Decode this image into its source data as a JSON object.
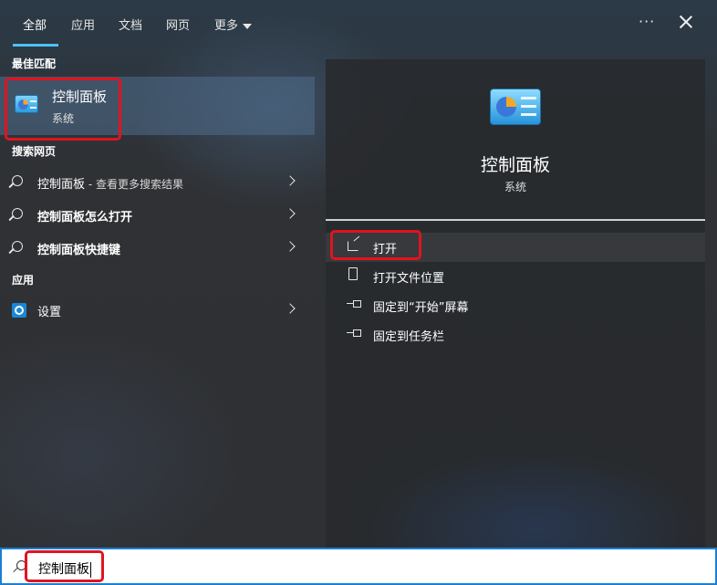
{
  "tabs": [
    {
      "label": "全部",
      "active": true
    },
    {
      "label": "应用"
    },
    {
      "label": "文档"
    },
    {
      "label": "网页"
    },
    {
      "label": "更多"
    }
  ],
  "header": {
    "more_icon": "ellipsis-icon",
    "close_icon": "close-icon"
  },
  "best_match": {
    "section_title": "最佳匹配",
    "title": "控制面板",
    "subtitle": "系统",
    "icon": "control-panel-icon"
  },
  "web_search": {
    "section_title": "搜索网页",
    "items": [
      {
        "label_bold": "控制面板",
        "suffix": " - 查看更多搜索结果"
      },
      {
        "label_bold": "控制面板怎么打开",
        "suffix": ""
      },
      {
        "label_bold": "控制面板快捷键",
        "suffix": ""
      }
    ]
  },
  "apps": {
    "section_title": "应用",
    "items": [
      {
        "label": "设置",
        "icon": "gear-icon"
      }
    ]
  },
  "details": {
    "title": "控制面板",
    "subtitle": "系统",
    "actions": [
      {
        "label": "打开",
        "icon": "open-icon"
      },
      {
        "label": "打开文件位置",
        "icon": "folder-icon"
      },
      {
        "label": "固定到“开始”屏幕",
        "icon": "pin-icon"
      },
      {
        "label": "固定到任务栏",
        "icon": "pin-icon"
      }
    ]
  },
  "search": {
    "value": "控制面板"
  },
  "colors": {
    "accent": "#4cc2ff",
    "highlight_border": "#e0141f",
    "search_border": "#1a7fd4"
  }
}
